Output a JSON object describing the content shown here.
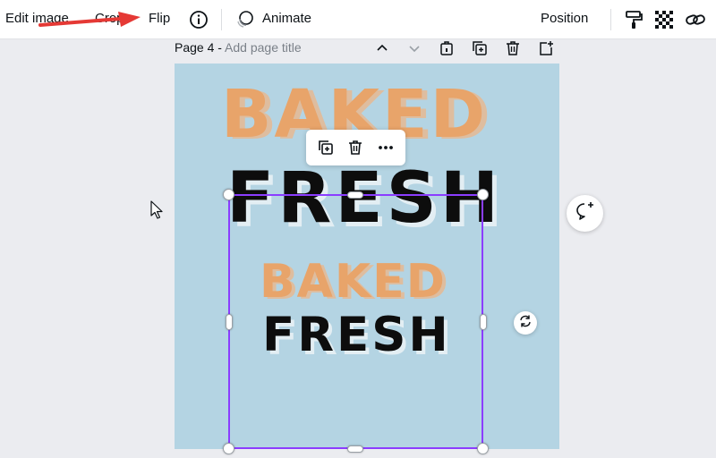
{
  "toolbar": {
    "edit_image": "Edit image",
    "crop": "Crop",
    "flip": "Flip",
    "animate": "Animate",
    "position": "Position"
  },
  "page": {
    "number_label": "Page 4 - ",
    "title_placeholder": "Add page title"
  },
  "canvas": {
    "background_color": "#b4d4e3",
    "words": {
      "baked_large": "BAKED",
      "fresh_large": "FRESH",
      "baked_small": "BAKED",
      "fresh_small": "FRESH"
    }
  },
  "colors": {
    "accent": "#8b3dff",
    "arrow": "#e53935",
    "baked": "#e8a46a"
  },
  "icons": [
    "info-icon",
    "animate-icon",
    "paint-roller-icon",
    "transparency-icon",
    "link-icon",
    "chevron-up-icon",
    "chevron-down-icon",
    "lock-icon",
    "duplicate-page-icon",
    "delete-page-icon",
    "add-page-icon",
    "copy-icon",
    "trash-icon",
    "more-icon",
    "comment-add-icon",
    "rotate-icon"
  ]
}
